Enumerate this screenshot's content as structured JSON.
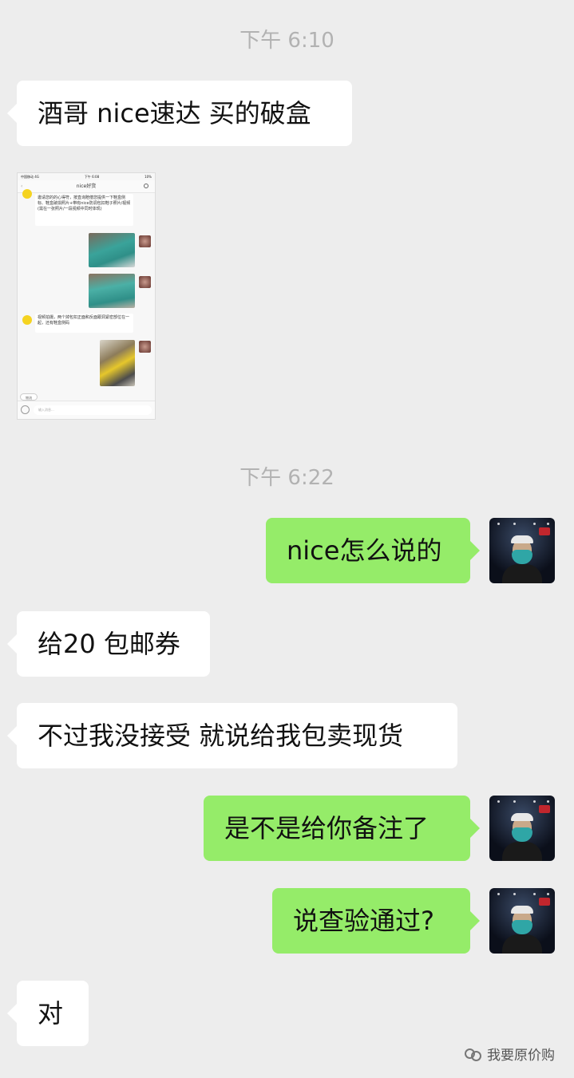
{
  "timestamps": [
    "下午 6:10",
    "下午 6:22"
  ],
  "messages": [
    {
      "side": "left",
      "text": "酒哥 nice速达 买的破盒"
    },
    {
      "side": "right",
      "text": "nice怎么说的"
    },
    {
      "side": "left",
      "text": "给20 包邮券"
    },
    {
      "side": "left",
      "text": "不过我没接受 就说给我包卖现货"
    },
    {
      "side": "right",
      "text": "是不是给你备注了"
    },
    {
      "side": "right",
      "text": "说查验通过?"
    },
    {
      "side": "left",
      "text": "对"
    }
  ],
  "screenshot": {
    "carrier": "中国移动  4G",
    "time": "下午 6:08",
    "battery": "10%",
    "title": "nice好货",
    "msg1": "邀请您的的心得符，按直询赔偿您提供一下鞋盒侧标、鞋盒破损照片+带有nice防调包扣鞋子照片/视频(需在一张照片/一段视频中同时体现)",
    "msg2": "视频拍摄，两个掉包扣正面和反面跟洞紧密部位在一起，还有鞋盒侧码",
    "pill": "物流",
    "input_placeholder": "输入消息..."
  },
  "watermark": "我要原价购",
  "colors": {
    "background": "#ededed",
    "bubble_left": "#ffffff",
    "bubble_right": "#95ec69",
    "timestamp": "#b2b2b2"
  }
}
